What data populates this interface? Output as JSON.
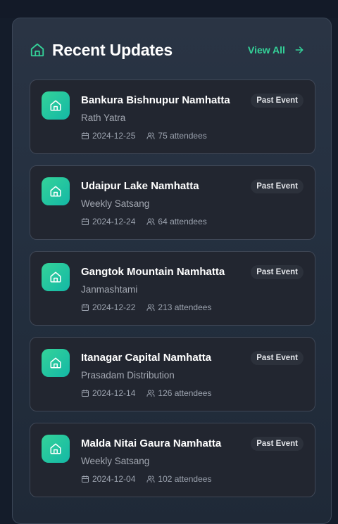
{
  "header": {
    "title": "Recent Updates",
    "view_all_label": "View All"
  },
  "colors": {
    "accent": "#34d399",
    "accent_dark": "#14b8a6",
    "card_bg": "#222630",
    "panel_bg": "#243040"
  },
  "updates": [
    {
      "title": "Bankura Bishnupur Namhatta",
      "subtitle": "Rath Yatra",
      "date": "2024-12-25",
      "attendees": "75 attendees",
      "badge": "Past Event"
    },
    {
      "title": "Udaipur Lake Namhatta",
      "subtitle": "Weekly Satsang",
      "date": "2024-12-24",
      "attendees": "64 attendees",
      "badge": "Past Event"
    },
    {
      "title": "Gangtok Mountain Namhatta",
      "subtitle": "Janmashtami",
      "date": "2024-12-22",
      "attendees": "213 attendees",
      "badge": "Past Event"
    },
    {
      "title": "Itanagar Capital Namhatta",
      "subtitle": "Prasadam Distribution",
      "date": "2024-12-14",
      "attendees": "126 attendees",
      "badge": "Past Event"
    },
    {
      "title": "Malda Nitai Gaura Namhatta",
      "subtitle": "Weekly Satsang",
      "date": "2024-12-04",
      "attendees": "102 attendees",
      "badge": "Past Event"
    }
  ],
  "icons": {
    "header": "home-icon",
    "card": "home-icon",
    "date": "calendar-icon",
    "attendees": "users-icon",
    "view_all": "arrow-right-icon"
  }
}
